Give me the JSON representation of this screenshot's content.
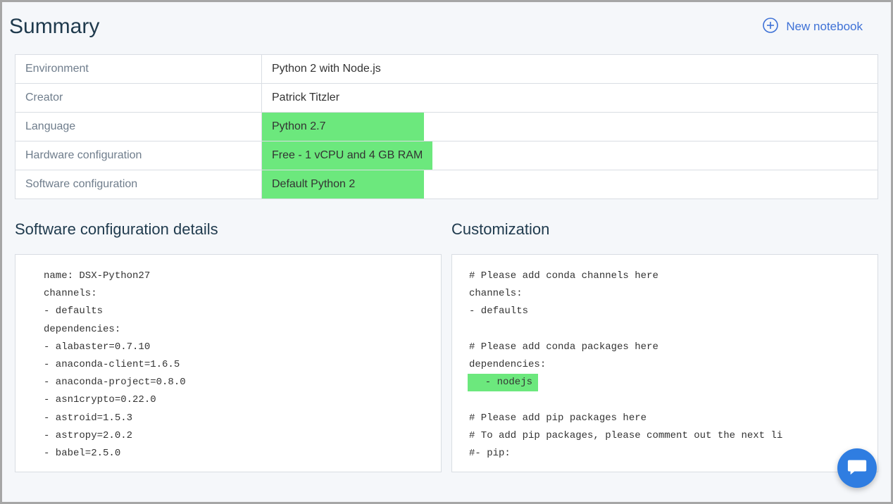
{
  "header": {
    "title": "Summary",
    "new_notebook_label": "New notebook"
  },
  "summary_rows": {
    "environment": {
      "key": "Environment",
      "value": "Python 2 with Node.js",
      "highlight": false
    },
    "creator": {
      "key": "Creator",
      "value": "Patrick Titzler",
      "highlight": false
    },
    "language": {
      "key": "Language",
      "value": "Python 2.7",
      "highlight": true
    },
    "hardware": {
      "key": "Hardware configuration",
      "value": "Free - 1 vCPU and 4 GB RAM",
      "highlight": true
    },
    "software": {
      "key": "Software configuration",
      "value": "Default Python 2",
      "highlight": true
    }
  },
  "details": {
    "title": "Software configuration details",
    "lines": [
      "name: DSX-Python27",
      "channels:",
      "- defaults",
      "dependencies:",
      "- alabaster=0.7.10",
      "- anaconda-client=1.6.5",
      "- anaconda-project=0.8.0",
      "- asn1crypto=0.22.0",
      "- astroid=1.5.3",
      "- astropy=2.0.2",
      "- babel=2.5.0"
    ]
  },
  "customization": {
    "title": "Customization",
    "lines": [
      "# Please add conda channels here",
      "channels:",
      "- defaults",
      "",
      "# Please add conda packages here",
      "dependencies:",
      "  - nodejs",
      "",
      "# Please add pip packages here",
      "# To add pip packages, please comment out the next li",
      "#- pip:"
    ],
    "highlight_line_index": 6
  },
  "chat": {
    "label": "chat"
  }
}
